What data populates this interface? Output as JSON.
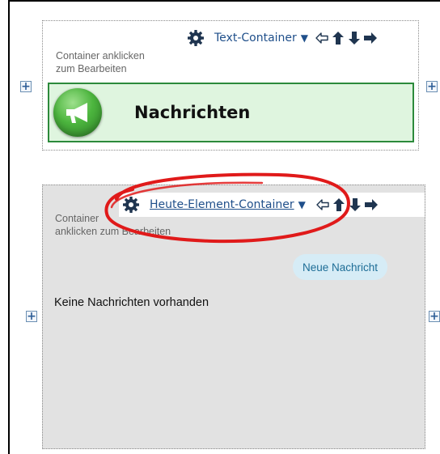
{
  "container1": {
    "toolbar": {
      "label": "Text-Container",
      "caret": "▼"
    },
    "hint_line1": "Container anklicken",
    "hint_line2": "zum Bearbeiten",
    "banner_title": "Nachrichten",
    "plus_label": "+"
  },
  "container2": {
    "toolbar": {
      "label": "Heute-Element-Container",
      "caret": "▼"
    },
    "hint_line1": "Container",
    "hint_line2": "anklicken zum Bearbeiten",
    "new_button": "Neue Nachricht",
    "empty_text": "Keine Nachrichten vorhanden",
    "plus_label": "+"
  },
  "colors": {
    "accent_link": "#1f4f8a",
    "banner_bg": "#dff5df",
    "banner_border": "#2c8a3b",
    "container_gray": "#e2e2e2",
    "highlight_red": "#e01a1a",
    "button_bg": "#d6ecf6"
  },
  "icons": [
    "gear-icon",
    "arrow-left-icon",
    "arrow-up-icon",
    "arrow-down-icon",
    "arrow-right-icon",
    "megaphone-icon",
    "plus-icon"
  ]
}
